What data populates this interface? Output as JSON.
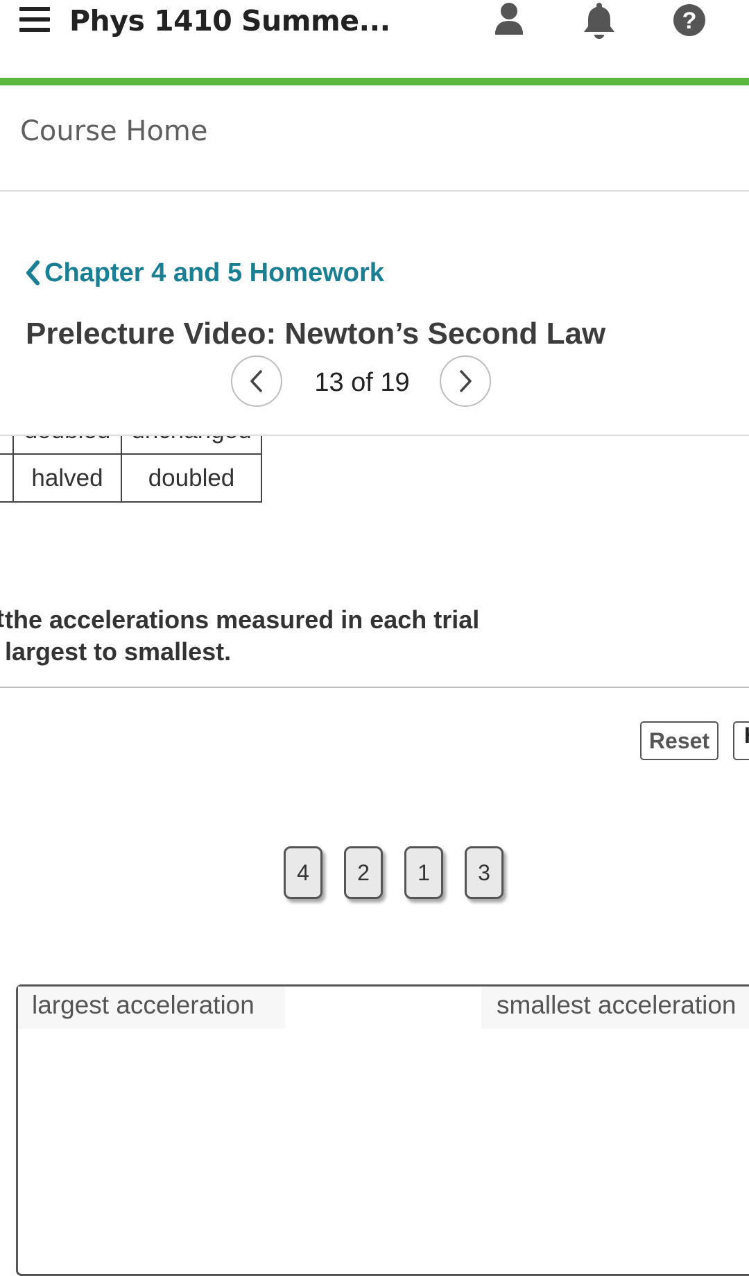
{
  "header": {
    "menu_icon": "hamburger-menu-icon",
    "title": "Phys 1410 Summe...",
    "icons": [
      "user-icon",
      "bell-icon",
      "help-icon"
    ]
  },
  "nav": {
    "course_home": "Course Home"
  },
  "assignment": {
    "back_label": "Chapter 4 and 5 Homework",
    "title": "Prelecture Video: Newton’s Second Law",
    "pager_text": "13 of 19"
  },
  "table": {
    "rows": [
      [
        "",
        "doubled",
        "unchanged"
      ],
      [
        "",
        "halved",
        "doubled"
      ]
    ]
  },
  "question": {
    "line1": "the accelerations measured in each trial",
    "line2": "largest to smallest.",
    "line1_prefix": "t"
  },
  "controls": {
    "reset_label": "Reset",
    "help_label": "H"
  },
  "tiles": [
    "4",
    "2",
    "1",
    "3"
  ],
  "ranking": {
    "left_label": "largest acceleration",
    "right_label": "smallest acceleration"
  },
  "colors": {
    "accent_green": "#5cb83e",
    "link_teal": "#1a7f93"
  }
}
